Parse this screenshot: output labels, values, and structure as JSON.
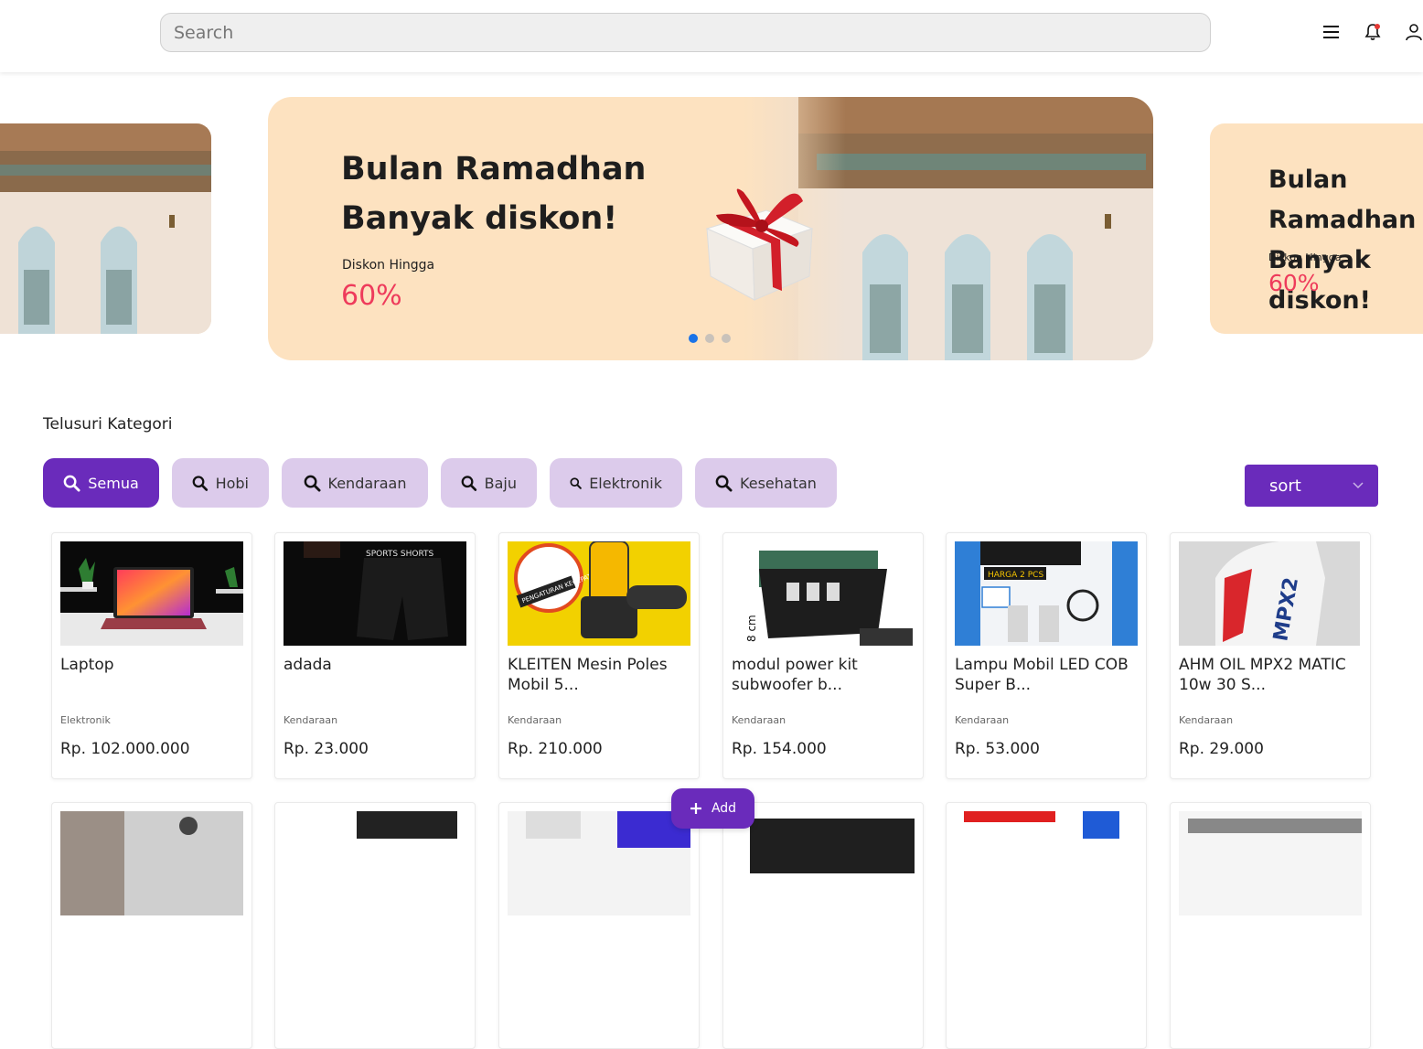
{
  "header": {
    "search_placeholder": "Search",
    "icons": [
      "menu-icon",
      "bell-icon",
      "user-icon"
    ]
  },
  "banner": {
    "title": "Bulan Ramadhan\nBanyak diskon!",
    "subtitle": "Diskon Hingga",
    "percent": "60%",
    "side_title": "Bulan Ramadhan\nBanyak diskon!",
    "side_subtitle": "Diskon Hingga",
    "side_percent": "60%",
    "slides": 3,
    "active_slide": 1
  },
  "categories": {
    "title": "Telusuri Kategori",
    "chips": [
      "Semua",
      "Hobi",
      "Kendaraan",
      "Baju",
      "Elektronik",
      "Kesehatan"
    ],
    "active": "Semua",
    "sort_label": "sort"
  },
  "products": [
    {
      "name": "Laptop",
      "category": "Elektronik",
      "price": "Rp. 102.000.000"
    },
    {
      "name": "adada",
      "category": "Kendaraan",
      "price": "Rp. 23.000",
      "image_text": "SPORTS SHORTS"
    },
    {
      "name": "KLEITEN Mesin Poles Mobil 5...",
      "category": "Kendaraan",
      "price": "Rp. 210.000",
      "image_text": "PENGATURAN KECEPATAN"
    },
    {
      "name": "modul power kit subwoofer b...",
      "category": "Kendaraan",
      "price": "Rp. 154.000",
      "image_text": "8 cm"
    },
    {
      "name": "Lampu Mobil LED COB Super B...",
      "category": "Kendaraan",
      "price": "Rp. 53.000",
      "image_text": "HARGA 2 PCS"
    },
    {
      "name": "AHM OIL MPX2 MATIC 10w 30 S...",
      "category": "Kendaraan",
      "price": "Rp. 29.000",
      "image_text": "MPX2"
    }
  ],
  "add_button": "Add",
  "colors": {
    "primary": "#6a2bbb",
    "chip": "#dccbeb",
    "banner_bg": "#fde2c0",
    "accent": "#ee3b5b",
    "dot_active": "#1a73e8"
  }
}
